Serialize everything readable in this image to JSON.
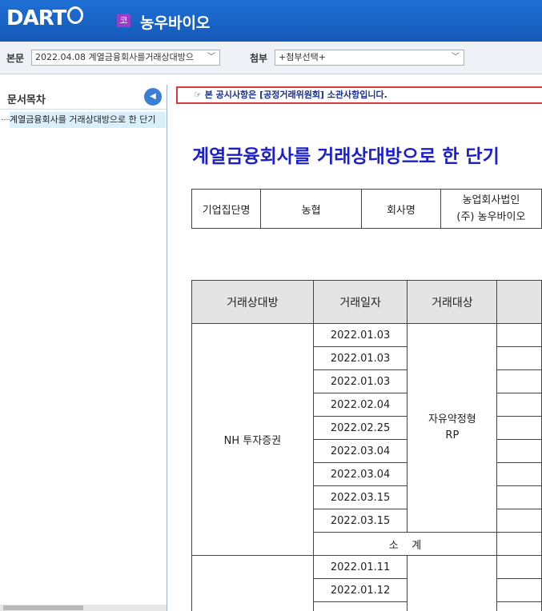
{
  "header": {
    "logo_text": "DART",
    "corp_badge": "코",
    "corp_name": "농우바이오"
  },
  "selectors": {
    "body_label": "본문",
    "body_value": "2022.04.08  계열금융회사를거래상대방으",
    "attach_label": "첨부",
    "attach_value": "+첨부선택+"
  },
  "sidebar": {
    "title": "문서목차",
    "items": [
      {
        "label": "계열금융회사를 거래상대방으로 한 단기"
      }
    ]
  },
  "notice": "☞ 본 공시사항은 [공정거래위원회] 소관사항입니다.",
  "document": {
    "title": "계열금융회사를 거래상대방으로 한 단기",
    "info": {
      "group_label": "기업집단명",
      "group_value": "농협",
      "company_label": "회사명",
      "company_value_line1": "농업회사법인",
      "company_value_line2": "(주) 농우바이오"
    },
    "table": {
      "headers": [
        "거래상대방",
        "거래일자",
        "거래대상"
      ],
      "groups": [
        {
          "counterparty": "NH 투자증권",
          "object": "자유약정형 RP",
          "dates": [
            "2022.01.03",
            "2022.01.03",
            "2022.01.03",
            "2022.02.04",
            "2022.02.25",
            "2022.03.04",
            "2022.03.04",
            "2022.03.15",
            "2022.03.15"
          ],
          "subtotal": "소    계"
        },
        {
          "counterparty": "",
          "object": "",
          "dates": [
            "2022.01.11",
            "2022.01.12",
            ""
          ],
          "subtotal": ""
        }
      ]
    }
  }
}
